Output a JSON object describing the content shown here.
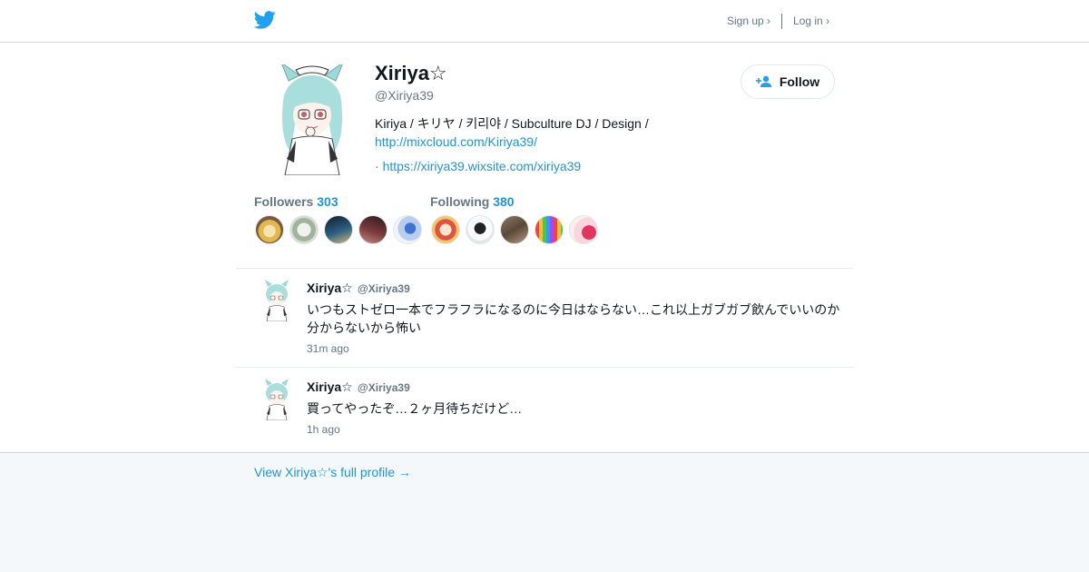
{
  "header": {
    "signup_label": "Sign up ›",
    "login_label": "Log in ›",
    "brand_color": "#1da1f2"
  },
  "profile": {
    "name": "Xiriya☆",
    "handle": "@Xiriya39",
    "bio": "Kiriya / キリヤ / 키리야 / Subculture DJ / Design /",
    "bio_link": "http://mixcloud.com/Kiriya39/",
    "web_prefix": "· ",
    "web_link": "https://xiriya39.wixsite.com/xiriya39",
    "follow_label": "Follow"
  },
  "stats": {
    "followers_label": "Followers",
    "followers_count": "303",
    "following_label": "Following",
    "following_count": "380"
  },
  "tweets": [
    {
      "name": "Xiriya☆",
      "handle": "@Xiriya39",
      "text": "いつもストゼロ一本でフラフラになるのに今日はならない…これ以上ガブガブ飲んでいいのか分からないから怖い",
      "time": "31m ago"
    },
    {
      "name": "Xiriya☆",
      "handle": "@Xiriya39",
      "text": "買ってやったぞ…２ヶ月待ちだけど…",
      "time": "1h ago"
    }
  ],
  "footer": {
    "full_profile_label": "View Xiriya☆'s full profile →"
  },
  "colors": {
    "accent": "#1b95e0",
    "muted": "#657786",
    "footer_bg": "#f5f8fa"
  }
}
